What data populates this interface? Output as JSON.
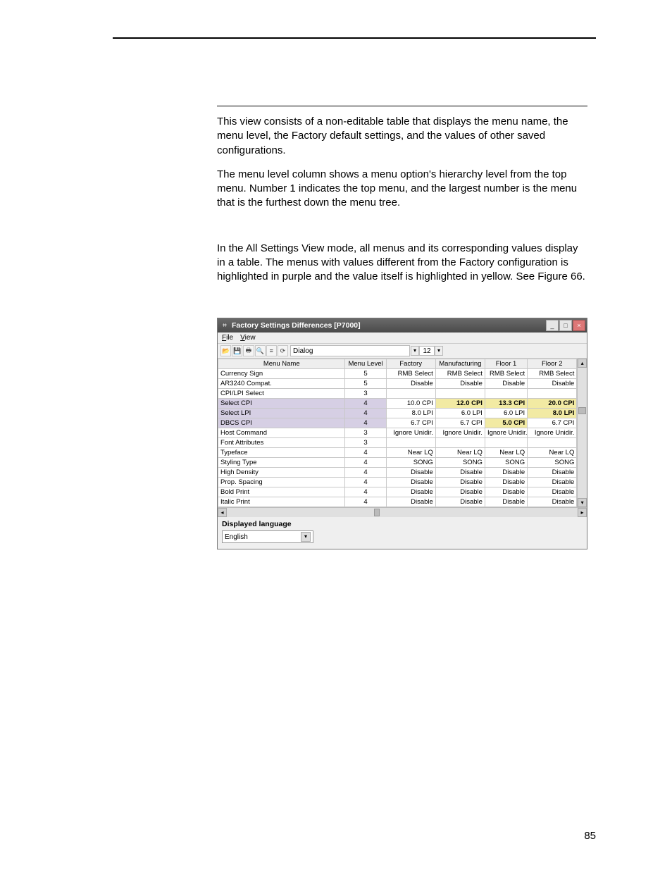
{
  "page_number": "85",
  "paragraphs": {
    "p1": "This view consists of a non-editable table that displays the menu name, the menu level, the Factory default settings, and the values of other saved configurations.",
    "p2": "The menu level column shows a menu option's hierarchy level from the top menu. Number 1 indicates the top menu, and the largest number is the menu that is the furthest down the menu tree.",
    "p3": "In the All Settings View mode, all menus and its corresponding values display in a table. The menus with values different from the Factory configuration is highlighted in purple and the value itself is highlighted in yellow. See Figure 66."
  },
  "window": {
    "title": "Factory Settings Differences  [P7000]",
    "menubar": {
      "file": "File",
      "view": "View"
    },
    "toolbar": {
      "font_name": "Dialog",
      "font_size": "12"
    },
    "table": {
      "headers": [
        "Menu Name",
        "Menu Level",
        "Factory",
        "Manufacturing",
        "Floor 1",
        "Floor 2"
      ],
      "rows": [
        {
          "name": "Currency Sign",
          "level": "5",
          "vals": [
            "RMB Select",
            "RMB Select",
            "RMB Select",
            "RMB Select"
          ],
          "hl": false,
          "hl_cols": []
        },
        {
          "name": "AR3240 Compat.",
          "level": "5",
          "vals": [
            "Disable",
            "Disable",
            "Disable",
            "Disable"
          ],
          "hl": false,
          "hl_cols": []
        },
        {
          "name": "CPI/LPI Select",
          "level": "3",
          "vals": [
            "",
            "",
            "",
            ""
          ],
          "hl": false,
          "hl_cols": []
        },
        {
          "name": "Select CPI",
          "level": "4",
          "vals": [
            "10.0 CPI",
            "12.0 CPI",
            "13.3 CPI",
            "20.0 CPI"
          ],
          "hl": true,
          "hl_cols": [
            1,
            2,
            3
          ]
        },
        {
          "name": "Select LPI",
          "level": "4",
          "vals": [
            "8.0 LPI",
            "6.0 LPI",
            "6.0 LPI",
            "8.0 LPI"
          ],
          "hl": true,
          "hl_cols": [
            3
          ]
        },
        {
          "name": "DBCS CPI",
          "level": "4",
          "vals": [
            "6.7 CPI",
            "6.7 CPI",
            "5.0 CPI",
            "6.7 CPI"
          ],
          "hl": true,
          "hl_cols": [
            2
          ]
        },
        {
          "name": "Host Command",
          "level": "3",
          "vals": [
            "Ignore Unidir.",
            "Ignore Unidir.",
            "Ignore Unidir.",
            "Ignore Unidir."
          ],
          "hl": false,
          "hl_cols": []
        },
        {
          "name": "Font Attributes",
          "level": "3",
          "vals": [
            "",
            "",
            "",
            ""
          ],
          "hl": false,
          "hl_cols": []
        },
        {
          "name": "Typeface",
          "level": "4",
          "vals": [
            "Near LQ",
            "Near LQ",
            "Near LQ",
            "Near LQ"
          ],
          "hl": false,
          "hl_cols": []
        },
        {
          "name": "Styling Type",
          "level": "4",
          "vals": [
            "SONG",
            "SONG",
            "SONG",
            "SONG"
          ],
          "hl": false,
          "hl_cols": []
        },
        {
          "name": "High Density",
          "level": "4",
          "vals": [
            "Disable",
            "Disable",
            "Disable",
            "Disable"
          ],
          "hl": false,
          "hl_cols": []
        },
        {
          "name": "Prop. Spacing",
          "level": "4",
          "vals": [
            "Disable",
            "Disable",
            "Disable",
            "Disable"
          ],
          "hl": false,
          "hl_cols": []
        },
        {
          "name": "Bold Print",
          "level": "4",
          "vals": [
            "Disable",
            "Disable",
            "Disable",
            "Disable"
          ],
          "hl": false,
          "hl_cols": []
        },
        {
          "name": "Italic Print",
          "level": "4",
          "vals": [
            "Disable",
            "Disable",
            "Disable",
            "Disable"
          ],
          "hl": false,
          "hl_cols": []
        }
      ]
    },
    "displayed_language_label": "Displayed language",
    "displayed_language_value": "English"
  }
}
